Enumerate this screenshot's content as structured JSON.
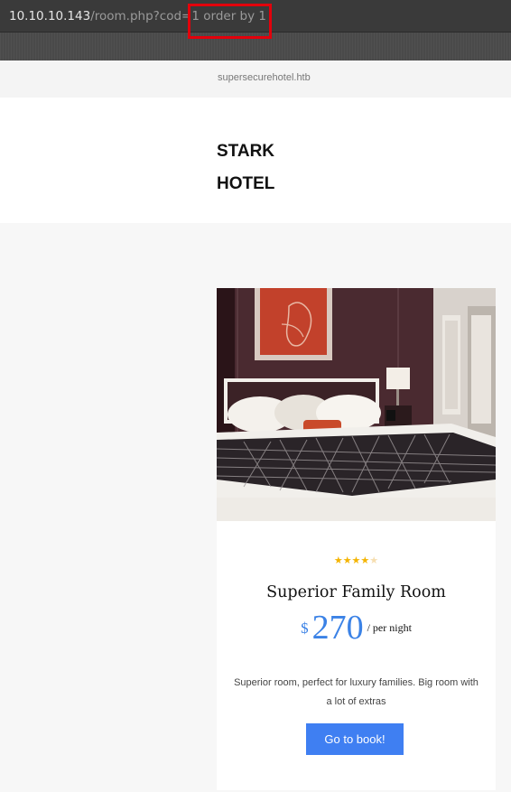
{
  "browser": {
    "url_host": "10.10.10.143",
    "url_path": "/room.php?cod=",
    "url_injection": "1 order by 1"
  },
  "site": {
    "domain": "supersecurehotel.htb",
    "brand_line1": "STARK",
    "brand_line2": "HOTEL"
  },
  "room": {
    "rating": 4,
    "rating_max": 5,
    "stars_filled": "★★★★",
    "stars_empty": "★",
    "name": "Superior Family Room",
    "currency": "$",
    "price": "270",
    "per_night": "/ per night",
    "description": "Superior room, perfect for luxury families. Big room with a lot of extras",
    "book_label": "Go to book!"
  },
  "colors": {
    "accent": "#3f7ff2",
    "highlight": "#e3000b",
    "star": "#f4b400"
  }
}
